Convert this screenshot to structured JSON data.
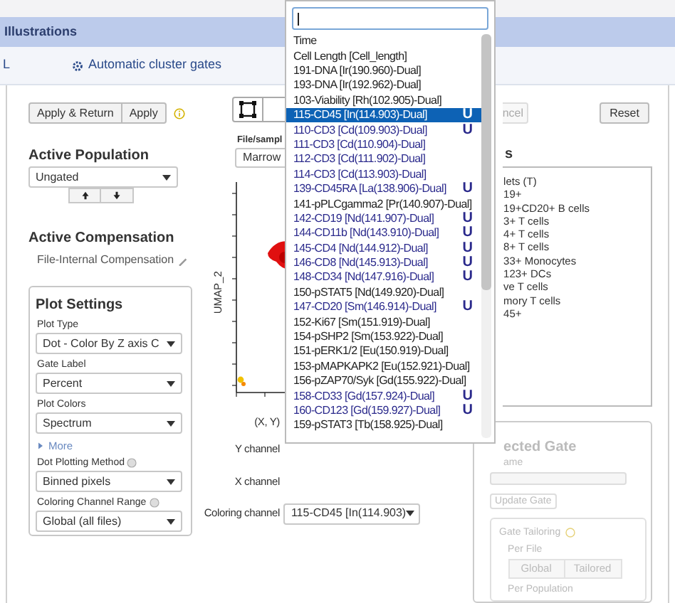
{
  "app_bar": {
    "title": "Illustrations"
  },
  "sub_bar": {
    "left_text": "L",
    "link": "Automatic cluster gates"
  },
  "left_panel": {
    "buttons": [
      "Apply & Return",
      "Apply"
    ],
    "active_population": {
      "heading": "Active Population",
      "value": "Ungated"
    },
    "active_compensation": {
      "heading": "Active Compensation",
      "value": "File-Internal Compensation"
    },
    "plot_settings": {
      "title": "Plot Settings",
      "items": [
        {
          "kind": "select",
          "label": "Plot Type",
          "value": "Dot - Color By Z axis C",
          "help": false
        },
        {
          "kind": "select",
          "label": "Gate Label",
          "value": "Percent",
          "help": false
        },
        {
          "kind": "select",
          "label": "Plot Colors",
          "value": "Spectrum",
          "help": false
        },
        {
          "kind": "link",
          "label": "More"
        },
        {
          "kind": "select",
          "label": "Dot Plotting Method",
          "value": "Binned pixels",
          "help": true
        },
        {
          "kind": "select",
          "label": "Coloring Channel Range",
          "value": "Global (all files)",
          "help": true
        }
      ]
    }
  },
  "plot_panel": {
    "file_sample": {
      "label": "File/sampl",
      "value": "Marrow"
    },
    "plot": {
      "y_axis_label": "UMAP_2"
    },
    "channels": [
      {
        "label": "(X, Y)"
      },
      {
        "label": "Y channel"
      },
      {
        "label": "X channel"
      },
      {
        "label": "Coloring channel",
        "value": "115-CD45 [In(114.903)"
      }
    ]
  },
  "right_panel": {
    "buttons": [
      {
        "label": "ncel",
        "disabled": true
      },
      {
        "label": "Reset",
        "disabled": false
      }
    ],
    "gates": {
      "heading": "s",
      "items": [
        "lets (T)",
        "19+",
        "19+CD20+ B cells",
        "3+ T cells",
        "4+ T cells",
        "8+ T cells",
        "33+ Monocytes",
        "123+ DCs",
        "ve T cells",
        "mory T cells",
        "45+"
      ]
    },
    "selected_gate": {
      "disabled": true,
      "heading": "ected Gate",
      "name_label": "ame",
      "update_button": "Update Gate",
      "tailoring": {
        "title": "Gate Tailoring",
        "per_file_label": "Per File",
        "options": [
          "Global",
          "Tailored"
        ],
        "per_population_label": "Per Population"
      }
    }
  },
  "channel_menu": {
    "items": [
      {
        "label": "Time",
        "kind": "plain",
        "selected": false
      },
      {
        "label": "Cell Length [Cell_length]",
        "kind": "plain",
        "selected": false
      },
      {
        "label": "191-DNA [Ir(190.960)-Dual]",
        "kind": "plain",
        "selected": false
      },
      {
        "label": "193-DNA [Ir(192.962)-Dual]",
        "kind": "plain",
        "selected": false
      },
      {
        "label": "103-Viability [Rh(102.905)-Dual]",
        "kind": "plain",
        "selected": false
      },
      {
        "label": "115-CD45 [In(114.903)-Dual]",
        "kind": "marker",
        "badge": "U",
        "selected": true
      },
      {
        "label": "110-CD3 [Cd(109.903)-Dual]",
        "kind": "marker",
        "badge": "U",
        "selected": false
      },
      {
        "label": "111-CD3 [Cd(110.904)-Dual]",
        "kind": "marker",
        "selected": false
      },
      {
        "label": "112-CD3 [Cd(111.902)-Dual]",
        "kind": "marker",
        "selected": false
      },
      {
        "label": "114-CD3 [Cd(113.903)-Dual]",
        "kind": "marker",
        "selected": false
      },
      {
        "label": "139-CD45RA [La(138.906)-Dual]",
        "kind": "marker",
        "badge": "U",
        "selected": false
      },
      {
        "label": "141-pPLCgamma2 [Pr(140.907)-Dual]",
        "kind": "plain",
        "selected": false
      },
      {
        "label": "142-CD19 [Nd(141.907)-Dual]",
        "kind": "marker",
        "badge": "U",
        "selected": false
      },
      {
        "label": "144-CD11b [Nd(143.910)-Dual]",
        "kind": "marker",
        "badge": "U",
        "selected": false
      },
      {
        "label": "145-CD4 [Nd(144.912)-Dual]",
        "kind": "marker",
        "badge": "U",
        "selected": false
      },
      {
        "label": "146-CD8 [Nd(145.913)-Dual]",
        "kind": "marker",
        "badge": "U",
        "selected": false
      },
      {
        "label": "148-CD34 [Nd(147.916)-Dual]",
        "kind": "marker",
        "badge": "U",
        "selected": false
      },
      {
        "label": "150-pSTAT5 [Nd(149.920)-Dual]",
        "kind": "plain",
        "selected": false
      },
      {
        "label": "147-CD20 [Sm(146.914)-Dual]",
        "kind": "marker",
        "badge": "U",
        "selected": false
      },
      {
        "label": "152-Ki67 [Sm(151.919)-Dual]",
        "kind": "plain",
        "selected": false
      },
      {
        "label": "154-pSHP2 [Sm(153.922)-Dual]",
        "kind": "plain",
        "selected": false
      },
      {
        "label": "151-pERK1/2 [Eu(150.919)-Dual]",
        "kind": "plain",
        "selected": false
      },
      {
        "label": "153-pMAPKAPK2 [Eu(152.921)-Dual]",
        "kind": "plain",
        "selected": false
      },
      {
        "label": "156-pZAP70/Syk [Gd(155.922)-Dual]",
        "kind": "plain",
        "selected": false
      },
      {
        "label": "158-CD33 [Gd(157.924)-Dual]",
        "kind": "marker",
        "badge": "U",
        "selected": false
      },
      {
        "label": "160-CD123 [Gd(159.927)-Dual]",
        "kind": "marker",
        "badge": "U",
        "selected": false
      },
      {
        "label": "159-pSTAT3 [Tb(158.925)-Dual]",
        "kind": "plain",
        "selected": false
      }
    ]
  }
}
